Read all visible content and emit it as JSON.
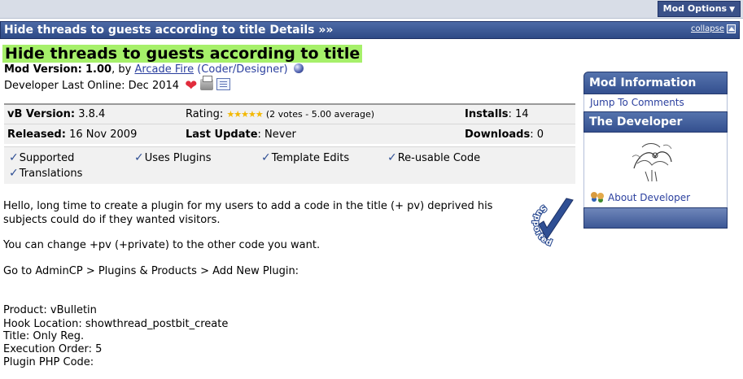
{
  "topbar": {
    "mod_options": "Mod Options"
  },
  "detail_bar": {
    "title": "Hide threads to guests according to title Details »»",
    "collapse": "collapse"
  },
  "header": {
    "title": "Hide threads to guests according to title",
    "mod_version_label": "Mod Version:",
    "mod_version": "1.00",
    "by": ", by",
    "author": "Arcade Fire",
    "role": "(Coder/Designer)",
    "last_online_label": "Developer Last Online:",
    "last_online": "Dec 2014"
  },
  "info": {
    "row1": {
      "vb_label": "vB Version:",
      "vb_value": "3.8.4",
      "rating_label": "Rating:",
      "rating_stars": "★★★★★",
      "rating_text": "(2 votes - 5.00 average)",
      "installs_label": "Installs",
      "installs_value": "14"
    },
    "row2": {
      "released_label": "Released:",
      "released_value": "16 Nov 2009",
      "update_label": "Last Update",
      "update_value": "Never",
      "downloads_label": "Downloads",
      "downloads_value": "0"
    }
  },
  "features": [
    "Supported",
    "Uses Plugins",
    "Template Edits",
    "Re-usable Code",
    "Translations"
  ],
  "body": {
    "p1a": "Hello, long time to create a plugin for my users to add a code in the title (+ pv) deprived his",
    "p1b": "subjects could do if they wanted visitors.",
    "p2": "You can change +pv (+private) to the other code you want.",
    "p3": "Go to AdminCP > Plugins & Products > Add New Plugin:",
    "l1": "Product: vBulletin",
    "l2": "Hook Location: showthread_postbit_create",
    "l3": "Title: Only Reg.",
    "l4": "Execution Order: 5",
    "l5": "Plugin PHP Code:"
  },
  "badge": {
    "text": "Supported"
  },
  "sidebar": {
    "mod_info": "Mod Information",
    "jump": "Jump To Comments",
    "developer": "The Developer",
    "about": "About Developer"
  },
  "colors": {
    "header_blue": "#34508f",
    "title_highlight": "#a6f06a",
    "link": "#2a3f9e"
  }
}
